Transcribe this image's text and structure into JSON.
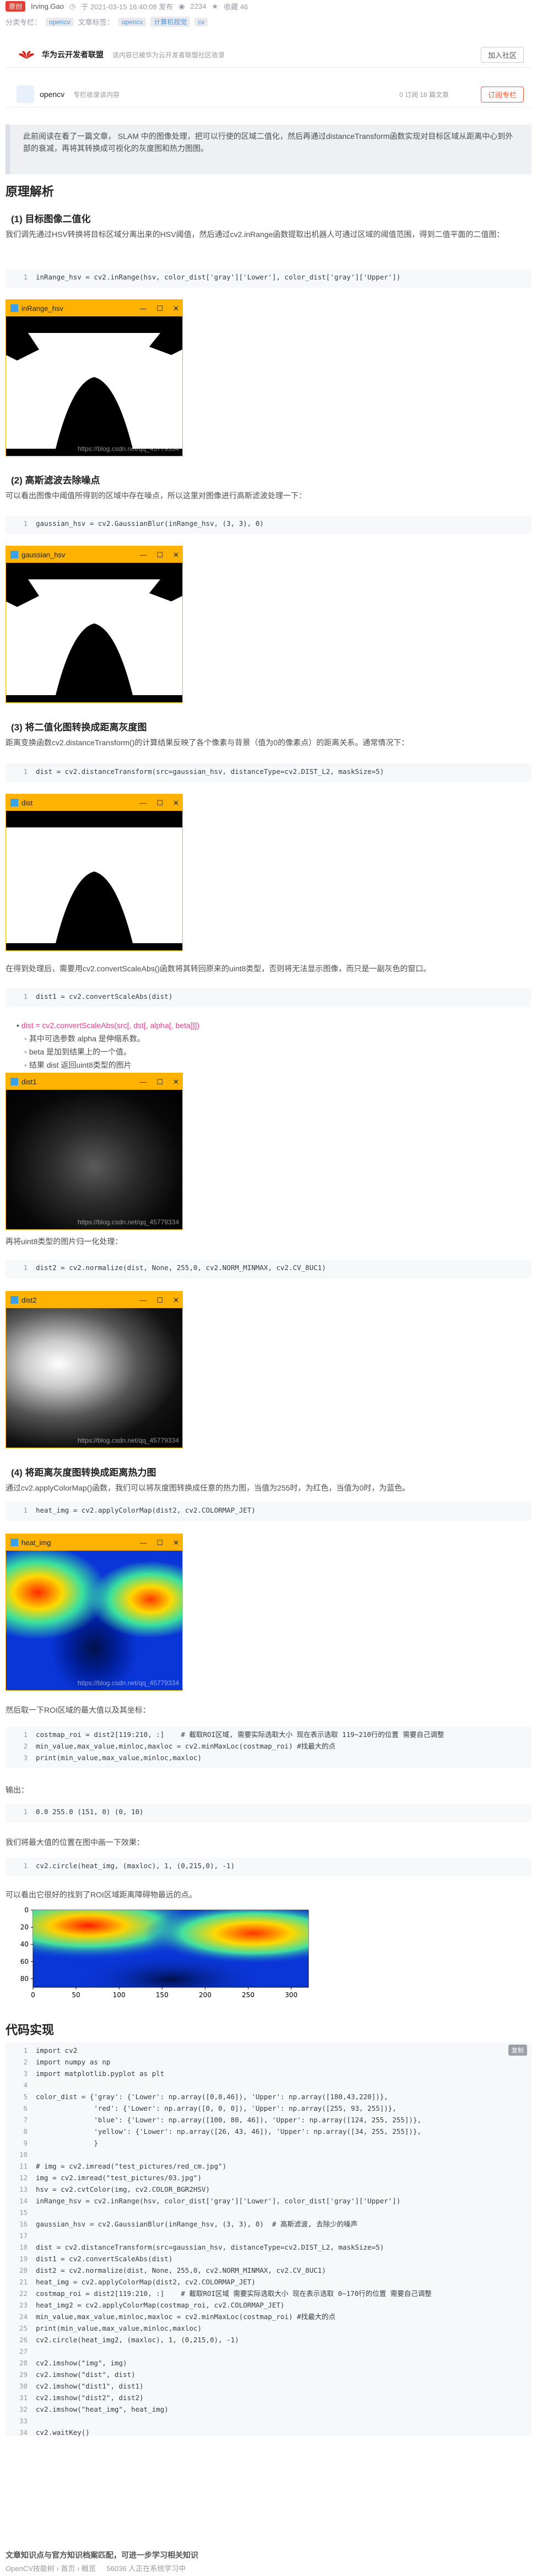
{
  "meta": {
    "original_badge": "原创",
    "author": "Irving.Gao",
    "published": "于 2021-03-15 16:40:08 发布",
    "views": "2234",
    "favorites": "收藏 46",
    "category_label": "分类专栏：",
    "categories": [
      "opencv",
      "文章标签："
    ],
    "tags": [
      "opencv",
      "计算机视觉",
      "cv"
    ]
  },
  "community": {
    "name": "华为云开发者联盟",
    "desc": "该内容已被华为云开发者联盟社区收录",
    "join_button": "加入社区"
  },
  "column": {
    "name": "opencv",
    "desc": "专栏收录该内容",
    "stats": "0 订阅  18 篇文章",
    "subscribe_button": "订阅专栏"
  },
  "intro": "此前阅读在看了一篇文章， SLAM 中的图像处理，把可以行使的区域二值化，然后再通过distanceTransform函数实现对目标区域从距离中心到外部的衰减，再将其转换成可视化的灰度图和热力图图。",
  "sections": {
    "principle": "原理解析",
    "s1": "(1) 目标图像二值化",
    "s1_p": "我们调先通过HSV转换将目标区域分离出来的HSV阈值，然后通过cv2.inRange函数提取出机器人可通过区域的阈值范围，得到二值平面的二值图：",
    "s2": "(2) 高斯滤波去除噪点",
    "s2_p": "可以看出图像中阈值所得到的区域中存在噪点，所以这里对图像进行高斯滤波处理一下：",
    "s3": "(3) 将二值化图转换成距离灰度图",
    "s3_p": "距离变换函数cv2.distanceTransform()的计算结果反映了各个像素与背景（值为0的像素点）的距离关系。通常情况下：",
    "s3_p2": "在得到处理后，需要用cv2.convertScaleAbs()函数将其转回原来的uint8类型，否则将无法显示图像，而只是一副灰色的窗口。",
    "s3_p3": "再将uint8类型的图片归一化处理：",
    "s4": "(4) 将距离灰度图转换成距离热力图",
    "s4_p": "通过cv2.applyColorMap()函数，我们可以将灰度图转换成任意的热力图，当值为255时，为红色，当值为0时，为蓝色。",
    "s4_p2": "然后取一下ROI区域的最大值以及其坐标：",
    "output": "输出：",
    "circle_p": "我们将最大值的位置在图中画一下效果：",
    "result_p": "可以看出它很好的找到了ROI区域距离障碍物最远的点。",
    "code_impl": "代码实现"
  },
  "bullets": [
    "其中可选参数 alpha 是伸缩系数。",
    "beta 是加到结果上的一个值。",
    "结果 dist 返回uint8类型的图片"
  ],
  "code": {
    "inrange": [
      "inRange_hsv = cv2.inRange(hsv, color_dist['gray']['Lower'], color_dist['gray']['Upper'])"
    ],
    "gauss": [
      "gaussian_hsv = cv2.GaussianBlur(inRange_hsv, (3, 3), 0)"
    ],
    "dist": [
      "dist = cv2.distanceTransform(src=gaussian_hsv, distanceType=cv2.DIST_L2, maskSize=5)"
    ],
    "dist1": [
      "dist1 = cv2.convertScaleAbs(dist)"
    ],
    "dist_formula": "dist = cv2.convertScaleAbs(src[, dst[, alpha[, beta]]])",
    "dist2": [
      "dist2 = cv2.normalize(dist, None, 255,0, cv2.NORM_MINMAX, cv2.CV_8UC1)"
    ],
    "heat": [
      "heat_img = cv2.applyColorMap(dist2, cv2.COLORMAP_JET)"
    ],
    "minmax": [
      "costmap_roi = dist2[119:210, :]    # 截取ROI区域, 需要实际选取大小 现在表示选取 119~210行的位置 需要自己调整",
      "min_value,max_value,minloc,maxloc = cv2.minMaxLoc(costmap_roi) #找最大的点",
      "print(min_value,max_value,minloc,maxloc)"
    ],
    "output": [
      "0.0 255.0 (151, 0) (0, 10)"
    ],
    "circle": [
      "cv2.circle(heat_img, (maxloc), 1, (0,215,0), -1)"
    ],
    "copy": "复制",
    "full": [
      "import cv2",
      "import numpy as np",
      "import matplotlib.pyplot as plt",
      "",
      "color_dist = {'gray': {'Lower': np.array([0,0,46]), 'Upper': np.array([180,43,220])},",
      "              'red': {'Lower': np.array([0, 0, 0]), 'Upper': np.array([255, 93, 255])},",
      "              'blue': {'Lower': np.array([100, 80, 46]), 'Upper': np.array([124, 255, 255])},",
      "              'yellow': {'Lower': np.array([26, 43, 46]), 'Upper': np.array([34, 255, 255])},",
      "              }",
      "",
      "# img = cv2.imread(\"test_pictures/red_cm.jpg\")",
      "img = cv2.imread(\"test_pictures/03.jpg\")",
      "hsv = cv2.cvtColor(img, cv2.COLOR_BGR2HSV)",
      "inRange_hsv = cv2.inRange(hsv, color_dist['gray']['Lower'], color_dist['gray']['Upper'])",
      "",
      "gaussian_hsv = cv2.GaussianBlur(inRange_hsv, (3, 3), 0)  # 高斯滤波, 去除少的噪声",
      "",
      "dist = cv2.distanceTransform(src=gaussian_hsv, distanceType=cv2.DIST_L2, maskSize=5)",
      "dist1 = cv2.convertScaleAbs(dist)",
      "dist2 = cv2.normalize(dist, None, 255,0, cv2.NORM_MINMAX, cv2.CV_8UC1)",
      "heat_img = cv2.applyColorMap(dist2, cv2.COLORMAP_JET)",
      "costmap_roi = dist2[119:210, :]    # 截取ROI区域 需要实际选取大小 现在表示选取 0~170行的位置 需要自己调整",
      "heat_img2 = cv2.applyColorMap(costmap_roi, cv2.COLORMAP_JET)",
      "min_value,max_value,minloc,maxloc = cv2.minMaxLoc(costmap_roi) #找最大的点",
      "print(min_value,max_value,minloc,maxloc)",
      "cv2.circle(heat_img2, (maxloc), 1, (0,215,0), -1)",
      "",
      "cv2.imshow(\"img\", img)",
      "cv2.imshow(\"dist\", dist)",
      "cv2.imshow(\"dist1\", dist1)",
      "cv2.imshow(\"dist2\", dist2)",
      "cv2.imshow(\"heat_img\", heat_img)",
      "",
      "cv2.waitKey()"
    ]
  },
  "windows": {
    "inrange": "inRange_hsv",
    "gauss": "gaussian_hsv",
    "dist": "dist",
    "dist1": "dist1",
    "dist2": "dist2",
    "heat": "heat_img",
    "watermark": "https://blog.csdn.net/qq_45779334"
  },
  "chart_data": {
    "type": "heatmap",
    "xticks": [
      0,
      50,
      100,
      150,
      200,
      250,
      300
    ],
    "yticks": [
      0,
      20,
      40,
      60,
      80
    ]
  },
  "footer": {
    "title": "文章知识点与官方知识档案匹配，可进一步学习相关知识",
    "path": "OpenCV技能树 › 首页 › 概览",
    "learners": "56036 人正在系统学习中"
  }
}
